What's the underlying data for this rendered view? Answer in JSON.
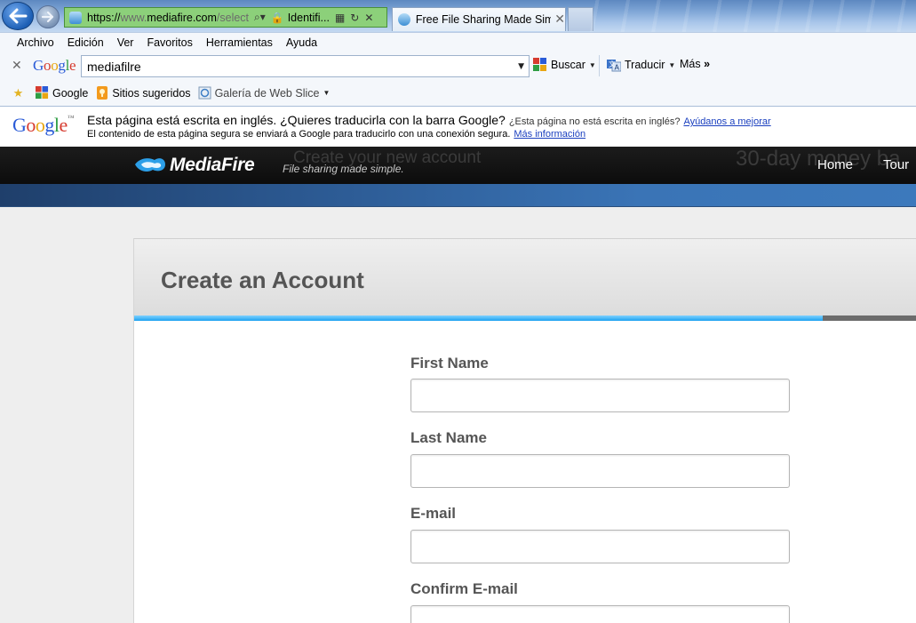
{
  "browser": {
    "address": {
      "url_main": "https://",
      "url_dim": "www.",
      "url_host": "mediafire.com",
      "url_path": "/select",
      "identity": "Identifi..."
    },
    "tab": {
      "title": "Free File Sharing Made Sim..."
    },
    "menu": [
      "Archivo",
      "Edición",
      "Ver",
      "Favoritos",
      "Herramientas",
      "Ayuda"
    ],
    "google_toolbar": {
      "logo": "Google",
      "search_value": "mediafilre",
      "search_label": "Buscar",
      "translate_label": "Traducir",
      "more_label": "Más"
    },
    "favorites": [
      {
        "label": "",
        "icon": "star-icon"
      },
      {
        "label": "Google",
        "icon": "google-icon"
      },
      {
        "label": "Sitios sugeridos",
        "icon": "suggested-sites-icon"
      },
      {
        "label": "Galería de Web Slice",
        "icon": "web-slice-icon"
      }
    ],
    "translate_bar": {
      "logo": "Google",
      "message": "Esta página está escrita en inglés. ¿Quieres traducirla con la barra Google?",
      "question": "¿Esta página no está escrita en inglés?",
      "help_link": "Ayúdanos a mejorar",
      "sub_message": "El contenido de esta página segura se enviará a Google para traducirlo con una conexión segura.",
      "more_link": "Más información"
    }
  },
  "site": {
    "logo": "MediaFire",
    "tagline": "File sharing made simple.",
    "ghost_left": "Create your new account",
    "ghost_right": "30-day money ba",
    "nav": [
      "Home",
      "Tour"
    ],
    "colors": {
      "accent": "#1da2f0",
      "header_bg": "#111111"
    }
  },
  "form": {
    "title": "Create an Account",
    "progress_fraction": 0.88,
    "fields": [
      {
        "label": "First Name",
        "value": ""
      },
      {
        "label": "Last Name",
        "value": ""
      },
      {
        "label": "E-mail",
        "value": ""
      },
      {
        "label": "Confirm E-mail",
        "value": ""
      }
    ]
  }
}
